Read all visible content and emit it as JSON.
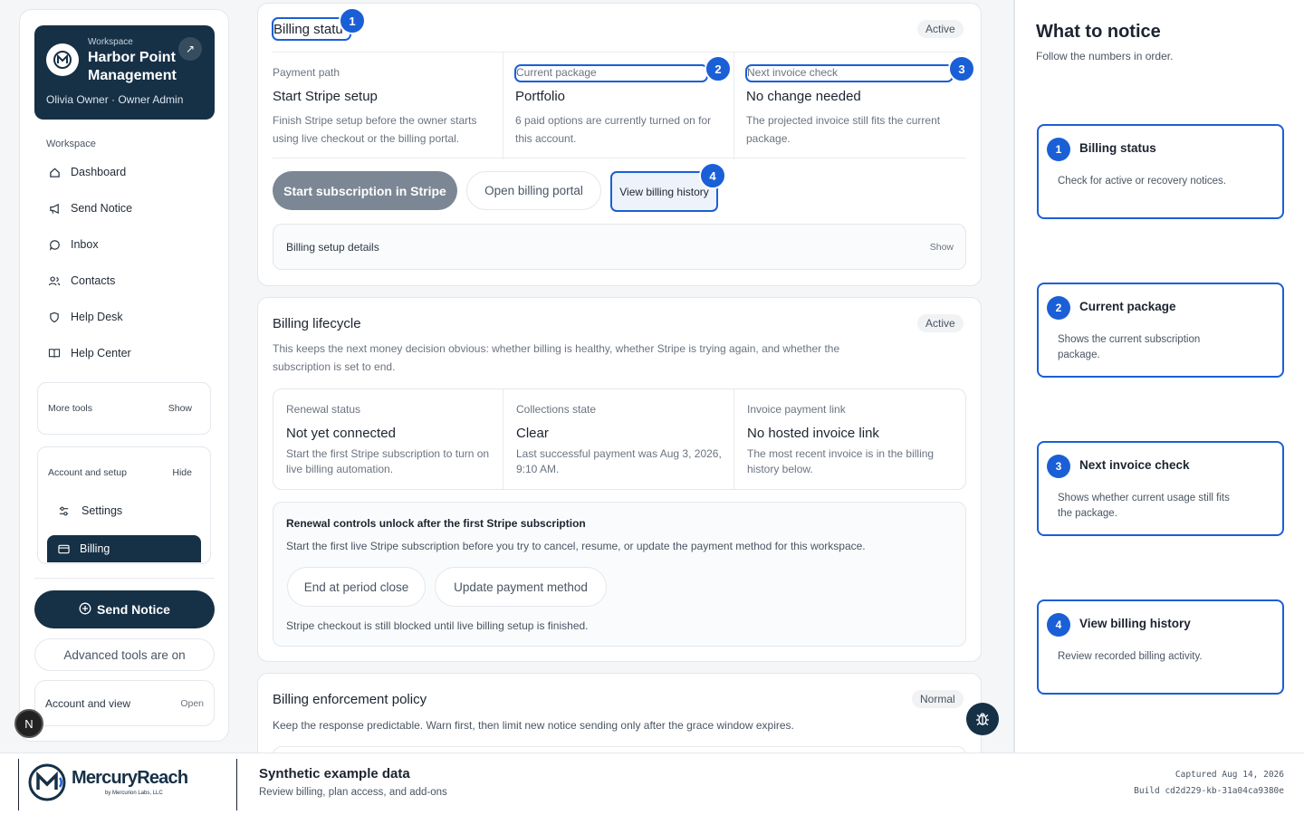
{
  "sidebar": {
    "workspace_kicker": "Workspace",
    "workspace_name": "Harbor Point Management",
    "user_line": "Olivia Owner · Owner Admin",
    "nav_heading": "Workspace",
    "items": [
      {
        "label": "Dashboard",
        "icon": "home-icon"
      },
      {
        "label": "Send Notice",
        "icon": "megaphone-icon"
      },
      {
        "label": "Inbox",
        "icon": "chat-icon"
      },
      {
        "label": "Contacts",
        "icon": "users-icon"
      },
      {
        "label": "Help Desk",
        "icon": "shield-icon"
      },
      {
        "label": "Help Center",
        "icon": "book-icon"
      }
    ],
    "more_tools": {
      "label": "More tools",
      "action": "Show"
    },
    "account_setup": {
      "label": "Account and setup",
      "action": "Hide"
    },
    "settings_label": "Settings",
    "billing_label": "Billing",
    "send_notice_btn": "Send Notice",
    "advanced_tools": "Advanced tools are on",
    "account_view": {
      "label": "Account and view",
      "action": "Open"
    },
    "n_badge": "N"
  },
  "billing_status": {
    "title": "Billing status",
    "status": "Active",
    "cells": [
      {
        "key": "Payment path",
        "value": "Start Stripe setup",
        "desc": "Finish Stripe setup before the owner starts using live checkout or the billing portal."
      },
      {
        "key": "Current package",
        "value": "Portfolio",
        "desc": "6 paid options are currently turned on for this account."
      },
      {
        "key": "Next invoice check",
        "value": "No change needed",
        "desc": "The projected invoice still fits the current package."
      }
    ],
    "btn_start": "Start subscription in Stripe",
    "btn_portal": "Open billing portal",
    "btn_history": "View billing history",
    "details_label": "Billing setup details",
    "details_action": "Show"
  },
  "lifecycle": {
    "title": "Billing lifecycle",
    "status": "Active",
    "desc": "This keeps the next money decision obvious: whether billing is healthy, whether Stripe is trying again, and whether the subscription is set to end.",
    "cells": [
      {
        "key": "Renewal status",
        "value": "Not yet connected",
        "desc": "Start the first Stripe subscription to turn on live billing automation."
      },
      {
        "key": "Collections state",
        "value": "Clear",
        "desc": "Last successful payment was Aug 3, 2026, 9:10 AM."
      },
      {
        "key": "Invoice payment link",
        "value": "No hosted invoice link",
        "desc": "The most recent invoice is in the billing history below."
      }
    ],
    "renewal_title": "Renewal controls unlock after the first Stripe subscription",
    "renewal_desc": "Start the first live Stripe subscription before you try to cancel, resume, or update the payment method for this workspace.",
    "btn_end": "End at period close",
    "btn_update": "Update payment method",
    "renewal_note": "Stripe checkout is still blocked until live billing setup is finished."
  },
  "enforcement": {
    "title": "Billing enforcement policy",
    "status": "Normal",
    "desc": "Keep the response predictable. Warn first, then limit new notice sending only after the grace window expires."
  },
  "callouts": [
    "1",
    "2",
    "3",
    "4"
  ],
  "right_panel": {
    "title": "What to notice",
    "subtitle": "Follow the numbers in order.",
    "notices": [
      {
        "n": "1",
        "title": "Billing status",
        "desc": "Check for active or recovery notices."
      },
      {
        "n": "2",
        "title": "Current package",
        "desc": "Shows the current subscription package."
      },
      {
        "n": "3",
        "title": "Next invoice check",
        "desc": "Shows whether current usage still fits the package."
      },
      {
        "n": "4",
        "title": "View billing history",
        "desc": "Review recorded billing activity."
      }
    ]
  },
  "footer": {
    "brand": "MercuryReach",
    "brand_sub": "by Mercurion Labs, LLC",
    "title": "Synthetic example data",
    "subtitle": "Review billing, plan access, and add-ons",
    "captured": "Captured Aug 14, 2026",
    "build": "Build cd2d229-kb-31a04ca9380e"
  },
  "colors": {
    "accent": "#1a5fd6",
    "navy": "#163046",
    "muted_btn": "#7b8794"
  }
}
